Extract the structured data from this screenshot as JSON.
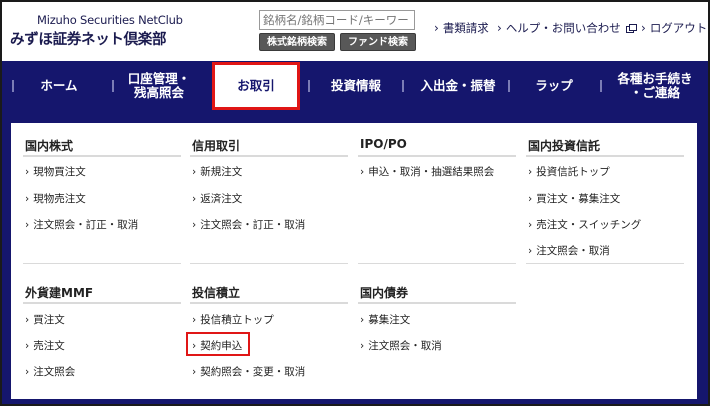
{
  "header": {
    "logo_en": "Mizuho Securities NetClub",
    "logo_jp": "みずほ証券ネット倶楽部",
    "search_placeholder": "銘柄名/銘柄コード/キーワード",
    "btn_stock_search": "株式銘柄検索",
    "btn_fund_search": "ファンド検索",
    "links": [
      {
        "label": "書類請求"
      },
      {
        "label": "ヘルプ・お問い合わせ"
      },
      {
        "label": "ログアウト"
      }
    ]
  },
  "nav": {
    "items": [
      {
        "label": "ホーム"
      },
      {
        "label": "口座管理・\n残高照会"
      },
      {
        "label": "お取引"
      },
      {
        "label": "投資情報"
      },
      {
        "label": "入出金・振替"
      },
      {
        "label": "ラップ"
      },
      {
        "label": "各種お手続き\n・ご連絡"
      }
    ]
  },
  "menu": {
    "domestic_stock": {
      "title": "国内株式",
      "links": [
        "現物買注文",
        "現物売注文",
        "注文照会・訂正・取消"
      ]
    },
    "margin": {
      "title": "信用取引",
      "links": [
        "新規注文",
        "返済注文",
        "注文照会・訂正・取消"
      ]
    },
    "ipo": {
      "title": "IPO/PO",
      "links": [
        "申込・取消・抽選結果照会"
      ]
    },
    "domestic_fund": {
      "title": "国内投資信託",
      "links": [
        "投資信託トップ",
        "買注文・募集注文",
        "売注文・スイッチング",
        "注文照会・取消"
      ]
    },
    "foreign_mmf": {
      "title": "外貨建MMF",
      "links": [
        "買注文",
        "売注文",
        "注文照会"
      ]
    },
    "fund_accum": {
      "title": "投信積立",
      "links": [
        "投信積立トップ",
        "契約申込",
        "契約照会・変更・取消"
      ]
    },
    "domestic_bond": {
      "title": "国内債券",
      "links": [
        "募集注文",
        "注文照会・取消"
      ]
    }
  },
  "colors": {
    "nav_bg": "#15166d",
    "highlight": "#e01616"
  }
}
